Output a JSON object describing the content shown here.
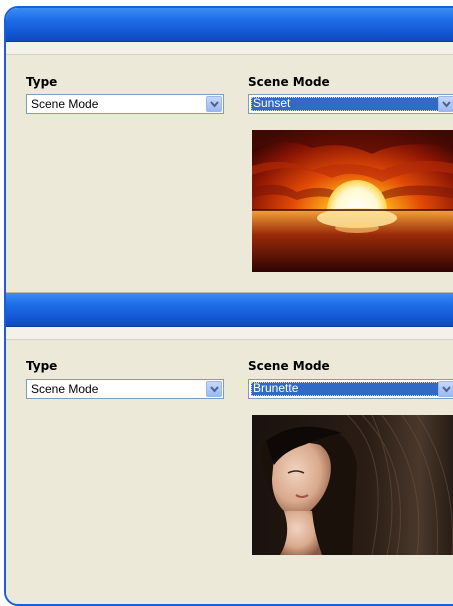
{
  "panels": [
    {
      "type_label": "Type",
      "type_value": "Scene Mode",
      "scene_label": "Scene Mode",
      "scene_value": "Sunset",
      "preview_icon": "sunset-photo"
    },
    {
      "type_label": "Type",
      "type_value": "Scene Mode",
      "scene_label": "Scene Mode",
      "scene_value": "Brunette",
      "preview_icon": "brunette-photo"
    }
  ],
  "colors": {
    "titlebar": "#1f6ee8",
    "background": "#ece9d8",
    "selection": "#316ac5"
  }
}
